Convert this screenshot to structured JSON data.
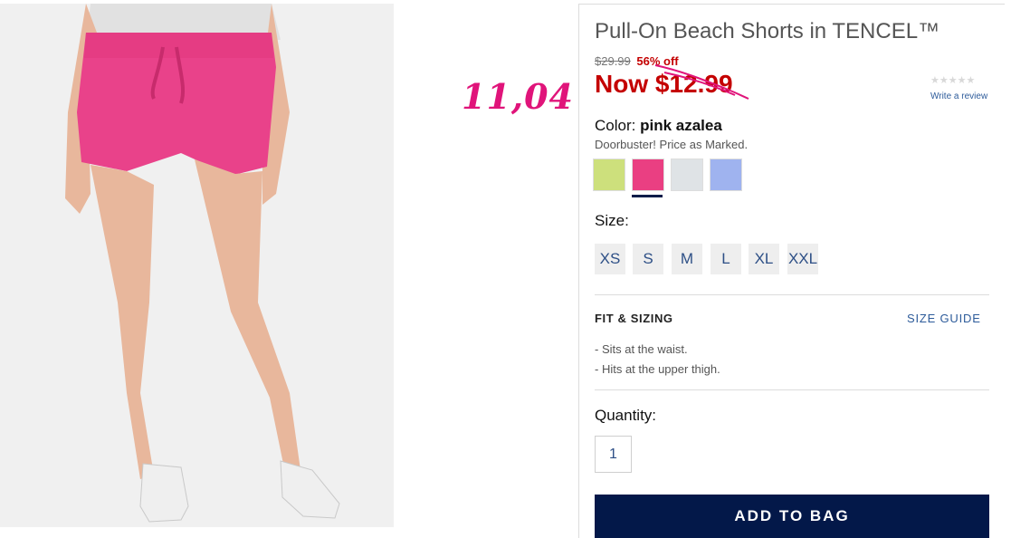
{
  "product": {
    "title": "Pull-On Beach Shorts in TENCEL™",
    "image_alt": "model wearing pink pull-on shorts and white sneakers"
  },
  "annotation": {
    "handwritten_text": "11,04"
  },
  "pricing": {
    "original_price": "$29.99",
    "percent_off": "56% off",
    "now_price": "Now $12.99"
  },
  "reviews": {
    "stars": "★★★★★",
    "write_review": "Write a review"
  },
  "color": {
    "label": "Color:",
    "selected": "pink azalea",
    "note": "Doorbuster! Price as Marked.",
    "swatches": [
      {
        "name": "lime",
        "color": "#cde07c"
      },
      {
        "name": "pink azalea",
        "color": "#ea3f82",
        "selected": true
      },
      {
        "name": "light grey",
        "color": "#dfe3e6"
      },
      {
        "name": "periwinkle",
        "color": "#9fb3ef"
      }
    ]
  },
  "size": {
    "label": "Size:",
    "options": [
      "XS",
      "S",
      "M",
      "L",
      "XL",
      "XXL"
    ]
  },
  "fit": {
    "heading": "FIT & SIZING",
    "guide_link": "SIZE GUIDE",
    "bullets": [
      "-  Sits at the waist.",
      "-  Hits at the upper thigh."
    ]
  },
  "quantity": {
    "label": "Quantity:",
    "value": "1"
  },
  "cta": {
    "add_to_bag": "ADD TO BAG"
  },
  "colors": {
    "sale_red": "#c40000",
    "brand_navy": "#031849",
    "link_blue": "#2d5b9a",
    "annotation_pink": "#e0147a"
  }
}
